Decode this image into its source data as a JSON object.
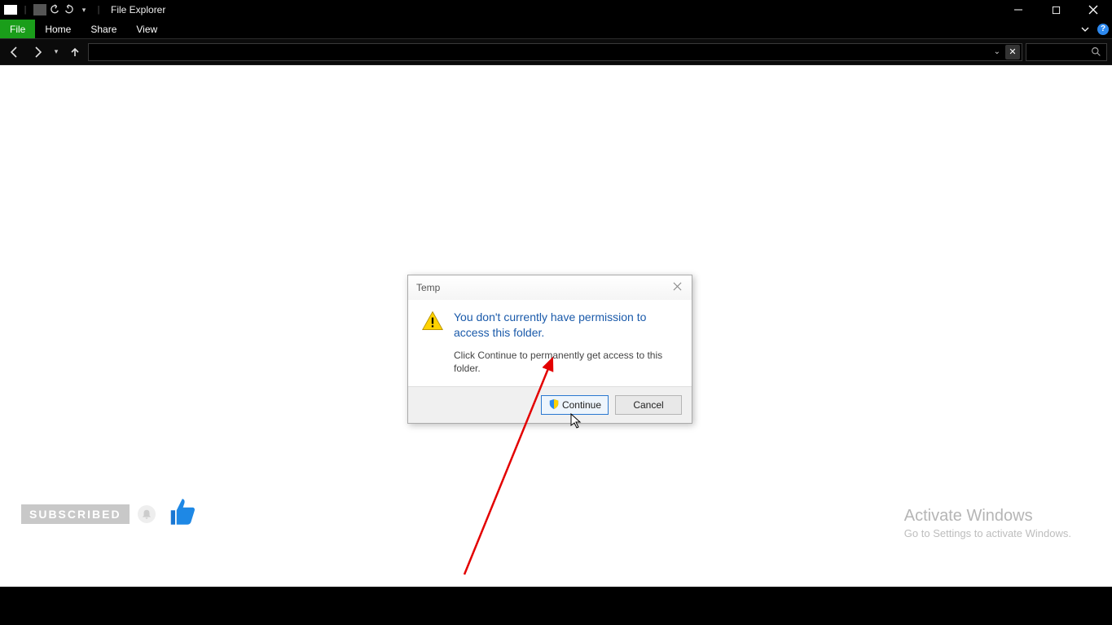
{
  "window": {
    "title": "File Explorer"
  },
  "ribbon": {
    "file": "File",
    "tabs": [
      "Home",
      "Share",
      "View"
    ]
  },
  "dialog": {
    "title": "Temp",
    "heading": "You don't currently have permission to access this folder.",
    "subtext": "Click Continue to permanently get access to this folder.",
    "continue_label": "Continue",
    "cancel_label": "Cancel"
  },
  "overlay": {
    "subscribed": "SUBSCRIBED"
  },
  "watermark": {
    "line1": "Activate Windows",
    "line2": "Go to Settings to activate Windows."
  }
}
